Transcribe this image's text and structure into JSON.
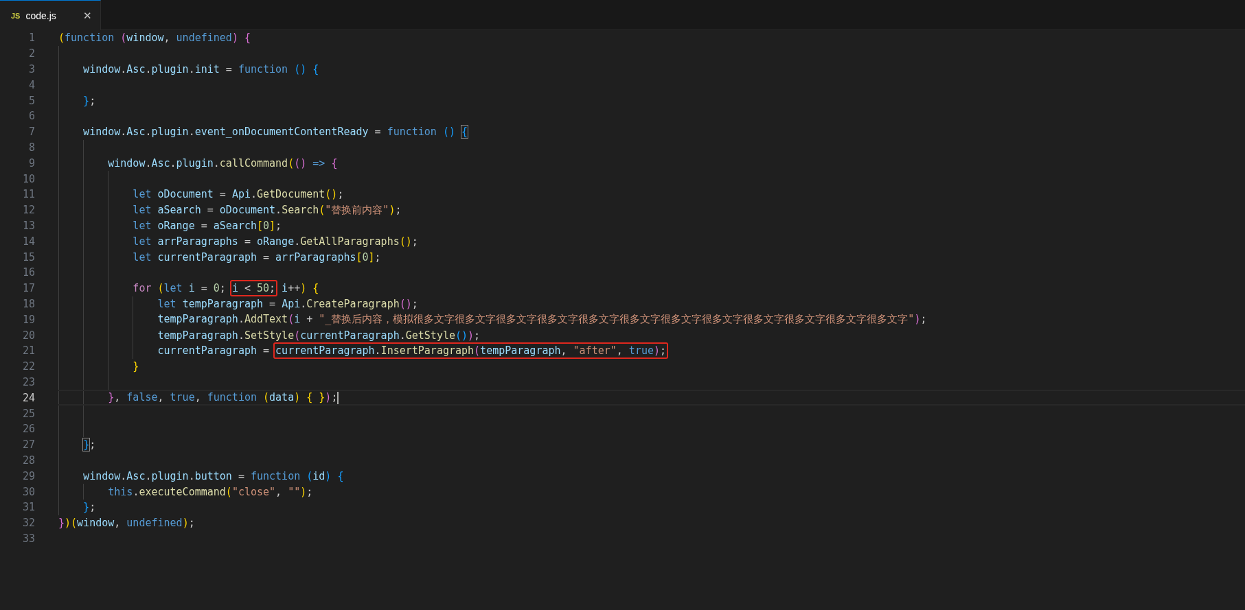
{
  "tabs": [
    {
      "icon_label": "JS",
      "title": "code.js",
      "close": "✕",
      "selected": true
    }
  ],
  "lines": [
    {
      "number": "1",
      "current": false,
      "tokens": [
        {
          "text": "(",
          "kind": "b1"
        },
        {
          "text": "function ",
          "kind": "kw"
        },
        {
          "text": "(",
          "kind": "b2"
        },
        {
          "text": "window",
          "kind": "var"
        },
        {
          "text": ", ",
          "kind": "pun"
        },
        {
          "text": "undefined",
          "kind": "kw"
        },
        {
          "text": ")",
          "kind": "b2"
        },
        {
          "text": " {",
          "kind": "b2"
        }
      ]
    },
    {
      "number": "2",
      "current": false
    },
    {
      "number": "3",
      "current": false,
      "tokens": [
        {
          "text": "    window",
          "kind": "var"
        },
        {
          "text": ".",
          "kind": "pun"
        },
        {
          "text": "Asc",
          "kind": "var"
        },
        {
          "text": ".",
          "kind": "pun"
        },
        {
          "text": "plugin",
          "kind": "var"
        },
        {
          "text": ".",
          "kind": "pun"
        },
        {
          "text": "init",
          "kind": "var"
        },
        {
          "text": " = ",
          "kind": "pun"
        },
        {
          "text": "function",
          "kind": "kw"
        },
        {
          "text": " ()",
          "kind": "b3"
        },
        {
          "text": " {",
          "kind": "b3"
        }
      ]
    },
    {
      "number": "4",
      "current": false
    },
    {
      "number": "5",
      "current": false,
      "tokens": [
        {
          "text": "    }",
          "kind": "b3"
        },
        {
          "text": ";",
          "kind": "pun"
        }
      ]
    },
    {
      "number": "6",
      "current": false
    },
    {
      "number": "7",
      "current": false,
      "tokens": [
        {
          "text": "    window",
          "kind": "var"
        },
        {
          "text": ".",
          "kind": "pun"
        },
        {
          "text": "Asc",
          "kind": "var"
        },
        {
          "text": ".",
          "kind": "pun"
        },
        {
          "text": "plugin",
          "kind": "var"
        },
        {
          "text": ".",
          "kind": "pun"
        },
        {
          "text": "event_onDocumentContentReady",
          "kind": "var"
        },
        {
          "text": " = ",
          "kind": "pun"
        },
        {
          "text": "function",
          "kind": "kw"
        },
        {
          "text": " ()",
          "kind": "b3"
        },
        {
          "text": " {",
          "kind": "b3",
          "matched": true
        }
      ]
    },
    {
      "number": "8",
      "current": false
    },
    {
      "number": "9",
      "current": false,
      "tokens": [
        {
          "text": "        window",
          "kind": "var"
        },
        {
          "text": ".",
          "kind": "pun"
        },
        {
          "text": "Asc",
          "kind": "var"
        },
        {
          "text": ".",
          "kind": "pun"
        },
        {
          "text": "plugin",
          "kind": "var"
        },
        {
          "text": ".",
          "kind": "pun"
        },
        {
          "text": "callCommand",
          "kind": "fn"
        },
        {
          "text": "(",
          "kind": "b1"
        },
        {
          "text": "()",
          "kind": "b2"
        },
        {
          "text": " => ",
          "kind": "kw"
        },
        {
          "text": "{",
          "kind": "b2"
        }
      ]
    },
    {
      "number": "10",
      "current": false
    },
    {
      "number": "11",
      "current": false,
      "tokens": [
        {
          "text": "            let ",
          "kind": "kw"
        },
        {
          "text": "oDocument",
          "kind": "var"
        },
        {
          "text": " = ",
          "kind": "pun"
        },
        {
          "text": "Api",
          "kind": "var"
        },
        {
          "text": ".",
          "kind": "pun"
        },
        {
          "text": "GetDocument",
          "kind": "fn"
        },
        {
          "text": "()",
          "kind": "b1"
        },
        {
          "text": ";",
          "kind": "pun"
        }
      ]
    },
    {
      "number": "12",
      "current": false,
      "tokens": [
        {
          "text": "            let ",
          "kind": "kw"
        },
        {
          "text": "aSearch",
          "kind": "var"
        },
        {
          "text": " = ",
          "kind": "pun"
        },
        {
          "text": "oDocument",
          "kind": "var"
        },
        {
          "text": ".",
          "kind": "pun"
        },
        {
          "text": "Search",
          "kind": "fn"
        },
        {
          "text": "(",
          "kind": "b1"
        },
        {
          "text": "\"替换前内容\"",
          "kind": "str"
        },
        {
          "text": ")",
          "kind": "b1"
        },
        {
          "text": ";",
          "kind": "pun"
        }
      ]
    },
    {
      "number": "13",
      "current": false,
      "tokens": [
        {
          "text": "            let ",
          "kind": "kw"
        },
        {
          "text": "oRange",
          "kind": "var"
        },
        {
          "text": " = ",
          "kind": "pun"
        },
        {
          "text": "aSearch",
          "kind": "var"
        },
        {
          "text": "[",
          "kind": "b1"
        },
        {
          "text": "0",
          "kind": "num"
        },
        {
          "text": "]",
          "kind": "b1"
        },
        {
          "text": ";",
          "kind": "pun"
        }
      ]
    },
    {
      "number": "14",
      "current": false,
      "tokens": [
        {
          "text": "            let ",
          "kind": "kw"
        },
        {
          "text": "arrParagraphs",
          "kind": "var"
        },
        {
          "text": " = ",
          "kind": "pun"
        },
        {
          "text": "oRange",
          "kind": "var"
        },
        {
          "text": ".",
          "kind": "pun"
        },
        {
          "text": "GetAllParagraphs",
          "kind": "fn"
        },
        {
          "text": "()",
          "kind": "b1"
        },
        {
          "text": ";",
          "kind": "pun"
        }
      ]
    },
    {
      "number": "15",
      "current": false,
      "tokens": [
        {
          "text": "            let ",
          "kind": "kw"
        },
        {
          "text": "currentParagraph",
          "kind": "var"
        },
        {
          "text": " = ",
          "kind": "pun"
        },
        {
          "text": "arrParagraphs",
          "kind": "var"
        },
        {
          "text": "[",
          "kind": "b1"
        },
        {
          "text": "0",
          "kind": "num"
        },
        {
          "text": "]",
          "kind": "b1"
        },
        {
          "text": ";",
          "kind": "pun"
        }
      ]
    },
    {
      "number": "16",
      "current": false
    },
    {
      "number": "17",
      "current": false,
      "tokens": [
        {
          "text": "            for ",
          "kind": "ctl"
        },
        {
          "text": "(",
          "kind": "b1"
        },
        {
          "text": "let ",
          "kind": "kw"
        },
        {
          "text": "i",
          "kind": "var"
        },
        {
          "text": " = ",
          "kind": "pun"
        },
        {
          "text": "0",
          "kind": "num"
        },
        {
          "text": "; ",
          "kind": "pun"
        },
        {
          "kind": "marked",
          "tokens": [
            {
              "text": "i",
              "kind": "var"
            },
            {
              "text": " < ",
              "kind": "pun"
            },
            {
              "text": "50",
              "kind": "num"
            },
            {
              "text": ";",
              "kind": "pun"
            }
          ]
        },
        {
          "text": " i",
          "kind": "var"
        },
        {
          "text": "++",
          "kind": "pun"
        },
        {
          "text": ")",
          "kind": "b1"
        },
        {
          "text": " {",
          "kind": "b1"
        }
      ]
    },
    {
      "number": "18",
      "current": false,
      "tokens": [
        {
          "text": "                let ",
          "kind": "kw"
        },
        {
          "text": "tempParagraph",
          "kind": "var"
        },
        {
          "text": " = ",
          "kind": "pun"
        },
        {
          "text": "Api",
          "kind": "var"
        },
        {
          "text": ".",
          "kind": "pun"
        },
        {
          "text": "CreateParagraph",
          "kind": "fn"
        },
        {
          "text": "()",
          "kind": "b2"
        },
        {
          "text": ";",
          "kind": "pun"
        }
      ]
    },
    {
      "number": "19",
      "current": false,
      "tokens": [
        {
          "text": "                tempParagraph",
          "kind": "var"
        },
        {
          "text": ".",
          "kind": "pun"
        },
        {
          "text": "AddText",
          "kind": "fn"
        },
        {
          "text": "(",
          "kind": "b2"
        },
        {
          "text": "i",
          "kind": "var"
        },
        {
          "text": " + ",
          "kind": "pun"
        },
        {
          "text": "\"_替换后内容，模拟很多文字很多文字很多文字很多文字很多文字很多文字很多文字很多文字很多文字很多文字很多文字很多文字\"",
          "kind": "str"
        },
        {
          "text": ")",
          "kind": "b2"
        },
        {
          "text": ";",
          "kind": "pun"
        }
      ]
    },
    {
      "number": "20",
      "current": false,
      "tokens": [
        {
          "text": "                tempParagraph",
          "kind": "var"
        },
        {
          "text": ".",
          "kind": "pun"
        },
        {
          "text": "SetStyle",
          "kind": "fn"
        },
        {
          "text": "(",
          "kind": "b2"
        },
        {
          "text": "currentParagraph",
          "kind": "var"
        },
        {
          "text": ".",
          "kind": "pun"
        },
        {
          "text": "GetStyle",
          "kind": "fn"
        },
        {
          "text": "()",
          "kind": "b3"
        },
        {
          "text": ")",
          "kind": "b2"
        },
        {
          "text": ";",
          "kind": "pun"
        }
      ]
    },
    {
      "number": "21",
      "current": false,
      "tokens": [
        {
          "text": "                currentParagraph",
          "kind": "var"
        },
        {
          "text": " = ",
          "kind": "pun"
        },
        {
          "kind": "marked",
          "tokens": [
            {
              "text": "currentParagraph",
              "kind": "var"
            },
            {
              "text": ".",
              "kind": "pun"
            },
            {
              "text": "InsertParagraph",
              "kind": "fn"
            },
            {
              "text": "(",
              "kind": "b2"
            },
            {
              "text": "tempParagraph",
              "kind": "var"
            },
            {
              "text": ", ",
              "kind": "pun"
            },
            {
              "text": "\"after\"",
              "kind": "str"
            },
            {
              "text": ", ",
              "kind": "pun"
            },
            {
              "text": "true",
              "kind": "kw"
            },
            {
              "text": ")",
              "kind": "b2"
            },
            {
              "text": ";",
              "kind": "pun"
            }
          ]
        }
      ]
    },
    {
      "number": "22",
      "current": false,
      "tokens": [
        {
          "text": "            }",
          "kind": "b1"
        }
      ]
    },
    {
      "number": "23",
      "current": false
    },
    {
      "number": "24",
      "current": true,
      "tokens": [
        {
          "text": "        }",
          "kind": "b2"
        },
        {
          "text": ", ",
          "kind": "pun"
        },
        {
          "text": "false",
          "kind": "kw"
        },
        {
          "text": ", ",
          "kind": "pun"
        },
        {
          "text": "true",
          "kind": "kw"
        },
        {
          "text": ", ",
          "kind": "pun"
        },
        {
          "text": "function ",
          "kind": "kw"
        },
        {
          "text": "(",
          "kind": "b1"
        },
        {
          "text": "data",
          "kind": "var"
        },
        {
          "text": ")",
          "kind": "b1"
        },
        {
          "text": " { }",
          "kind": "b1"
        },
        {
          "text": ")",
          "kind": "b2"
        },
        {
          "text": ";",
          "kind": "pun"
        }
      ]
    },
    {
      "number": "25",
      "current": false
    },
    {
      "number": "26",
      "current": false
    },
    {
      "number": "27",
      "current": false,
      "tokens": [
        {
          "text": "    }",
          "kind": "b3",
          "matched": true
        },
        {
          "text": ";",
          "kind": "pun"
        }
      ]
    },
    {
      "number": "28",
      "current": false
    },
    {
      "number": "29",
      "current": false,
      "tokens": [
        {
          "text": "    window",
          "kind": "var"
        },
        {
          "text": ".",
          "kind": "pun"
        },
        {
          "text": "Asc",
          "kind": "var"
        },
        {
          "text": ".",
          "kind": "pun"
        },
        {
          "text": "plugin",
          "kind": "var"
        },
        {
          "text": ".",
          "kind": "pun"
        },
        {
          "text": "button",
          "kind": "var"
        },
        {
          "text": " = ",
          "kind": "pun"
        },
        {
          "text": "function",
          "kind": "kw"
        },
        {
          "text": " (",
          "kind": "b3"
        },
        {
          "text": "id",
          "kind": "var"
        },
        {
          "text": ")",
          "kind": "b3"
        },
        {
          "text": " {",
          "kind": "b3"
        }
      ]
    },
    {
      "number": "30",
      "current": false,
      "tokens": [
        {
          "text": "        this",
          "kind": "kw"
        },
        {
          "text": ".",
          "kind": "pun"
        },
        {
          "text": "executeCommand",
          "kind": "fn"
        },
        {
          "text": "(",
          "kind": "b1"
        },
        {
          "text": "\"close\"",
          "kind": "str"
        },
        {
          "text": ", ",
          "kind": "pun"
        },
        {
          "text": "\"\"",
          "kind": "str"
        },
        {
          "text": ")",
          "kind": "b1"
        },
        {
          "text": ";",
          "kind": "pun"
        }
      ]
    },
    {
      "number": "31",
      "current": false,
      "tokens": [
        {
          "text": "    }",
          "kind": "b3"
        },
        {
          "text": ";",
          "kind": "pun"
        }
      ]
    },
    {
      "number": "32",
      "current": false,
      "tokens": [
        {
          "text": "}",
          "kind": "b2"
        },
        {
          "text": ")(",
          "kind": "b1"
        },
        {
          "text": "window",
          "kind": "var"
        },
        {
          "text": ", ",
          "kind": "pun"
        },
        {
          "text": "undefined",
          "kind": "kw"
        },
        {
          "text": ")",
          "kind": "b1"
        },
        {
          "text": ";",
          "kind": "pun"
        }
      ]
    },
    {
      "number": "33",
      "current": false
    }
  ]
}
